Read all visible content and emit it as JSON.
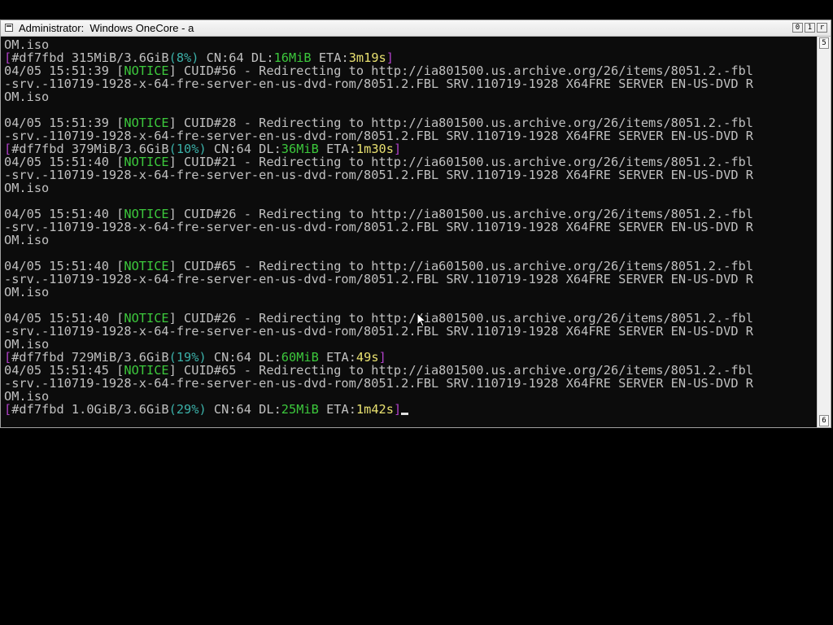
{
  "window": {
    "title": "Administrator:  Windows OneCore - a",
    "caption_buttons": [
      "0",
      "1",
      "r"
    ]
  },
  "scrollbar": {
    "up_label": "5",
    "down_label": "6"
  },
  "console": {
    "lines": [
      {
        "segments": [
          {
            "text": "OM.iso",
            "color": "default"
          }
        ]
      },
      {
        "segments": [
          {
            "text": "[",
            "color": "purple"
          },
          {
            "text": "#df7fbd 315MiB/3.6GiB",
            "color": "default"
          },
          {
            "text": "(8%)",
            "color": "cyan"
          },
          {
            "text": " CN:64 DL:",
            "color": "default"
          },
          {
            "text": "16MiB",
            "color": "green"
          },
          {
            "text": " ETA:",
            "color": "default"
          },
          {
            "text": "3m19s",
            "color": "yellow"
          },
          {
            "text": "]",
            "color": "purple"
          }
        ]
      },
      {
        "segments": [
          {
            "text": "04/05 15:51:39 [",
            "color": "default"
          },
          {
            "text": "NOTICE",
            "color": "green"
          },
          {
            "text": "] CUID#56 - Redirecting to http://ia801500.us.archive.org/26/items/8051.2.-fbl",
            "color": "default"
          }
        ]
      },
      {
        "segments": [
          {
            "text": "-srv.-110719-1928-x-64-fre-server-en-us-dvd-rom/8051.2.FBL_SRV.110719-1928_X64FRE_SERVER_EN-US-DVD_R",
            "color": "default"
          }
        ]
      },
      {
        "segments": [
          {
            "text": "OM.iso",
            "color": "default"
          }
        ]
      },
      {
        "segments": [
          {
            "text": "",
            "color": "default"
          }
        ]
      },
      {
        "segments": [
          {
            "text": "04/05 15:51:39 [",
            "color": "default"
          },
          {
            "text": "NOTICE",
            "color": "green"
          },
          {
            "text": "] CUID#28 - Redirecting to http://ia801500.us.archive.org/26/items/8051.2.-fbl",
            "color": "default"
          }
        ]
      },
      {
        "segments": [
          {
            "text": "-srv.-110719-1928-x-64-fre-server-en-us-dvd-rom/8051.2.FBL_SRV.110719-1928_X64FRE_SERVER_EN-US-DVD_R",
            "color": "default"
          }
        ]
      },
      {
        "segments": [
          {
            "text": "[",
            "color": "purple"
          },
          {
            "text": "#df7fbd 379MiB/3.6GiB",
            "color": "default"
          },
          {
            "text": "(10%)",
            "color": "cyan"
          },
          {
            "text": " CN:64 DL:",
            "color": "default"
          },
          {
            "text": "36MiB",
            "color": "green"
          },
          {
            "text": " ETA:",
            "color": "default"
          },
          {
            "text": "1m30s",
            "color": "yellow"
          },
          {
            "text": "]",
            "color": "purple"
          }
        ]
      },
      {
        "segments": [
          {
            "text": "04/05 15:51:40 [",
            "color": "default"
          },
          {
            "text": "NOTICE",
            "color": "green"
          },
          {
            "text": "] CUID#21 - Redirecting to http://ia601500.us.archive.org/26/items/8051.2.-fbl",
            "color": "default"
          }
        ]
      },
      {
        "segments": [
          {
            "text": "-srv.-110719-1928-x-64-fre-server-en-us-dvd-rom/8051.2.FBL_SRV.110719-1928_X64FRE_SERVER_EN-US-DVD_R",
            "color": "default"
          }
        ]
      },
      {
        "segments": [
          {
            "text": "OM.iso",
            "color": "default"
          }
        ]
      },
      {
        "segments": [
          {
            "text": "",
            "color": "default"
          }
        ]
      },
      {
        "segments": [
          {
            "text": "04/05 15:51:40 [",
            "color": "default"
          },
          {
            "text": "NOTICE",
            "color": "green"
          },
          {
            "text": "] CUID#26 - Redirecting to http://ia801500.us.archive.org/26/items/8051.2.-fbl",
            "color": "default"
          }
        ]
      },
      {
        "segments": [
          {
            "text": "-srv.-110719-1928-x-64-fre-server-en-us-dvd-rom/8051.2.FBL_SRV.110719-1928_X64FRE_SERVER_EN-US-DVD_R",
            "color": "default"
          }
        ]
      },
      {
        "segments": [
          {
            "text": "OM.iso",
            "color": "default"
          }
        ]
      },
      {
        "segments": [
          {
            "text": "",
            "color": "default"
          }
        ]
      },
      {
        "segments": [
          {
            "text": "04/05 15:51:40 [",
            "color": "default"
          },
          {
            "text": "NOTICE",
            "color": "green"
          },
          {
            "text": "] CUID#65 - Redirecting to http://ia601500.us.archive.org/26/items/8051.2.-fbl",
            "color": "default"
          }
        ]
      },
      {
        "segments": [
          {
            "text": "-srv.-110719-1928-x-64-fre-server-en-us-dvd-rom/8051.2.FBL_SRV.110719-1928_X64FRE_SERVER_EN-US-DVD_R",
            "color": "default"
          }
        ]
      },
      {
        "segments": [
          {
            "text": "OM.iso",
            "color": "default"
          }
        ]
      },
      {
        "segments": [
          {
            "text": "",
            "color": "default"
          }
        ]
      },
      {
        "segments": [
          {
            "text": "04/05 15:51:40 [",
            "color": "default"
          },
          {
            "text": "NOTICE",
            "color": "green"
          },
          {
            "text": "] CUID#26 - Redirecting to http://ia801500.us.archive.org/26/items/8051.2.-fbl",
            "color": "default"
          }
        ]
      },
      {
        "segments": [
          {
            "text": "-srv.-110719-1928-x-64-fre-server-en-us-dvd-rom/8051.2.FBL_SRV.110719-1928_X64FRE_SERVER_EN-US-DVD_R",
            "color": "default"
          }
        ]
      },
      {
        "segments": [
          {
            "text": "OM.iso",
            "color": "default"
          }
        ]
      },
      {
        "segments": [
          {
            "text": "[",
            "color": "purple"
          },
          {
            "text": "#df7fbd 729MiB/3.6GiB",
            "color": "default"
          },
          {
            "text": "(19%)",
            "color": "cyan"
          },
          {
            "text": " CN:64 DL:",
            "color": "default"
          },
          {
            "text": "60MiB",
            "color": "green"
          },
          {
            "text": " ETA:",
            "color": "default"
          },
          {
            "text": "49s",
            "color": "yellow"
          },
          {
            "text": "]",
            "color": "purple"
          }
        ]
      },
      {
        "segments": [
          {
            "text": "04/05 15:51:45 [",
            "color": "default"
          },
          {
            "text": "NOTICE",
            "color": "green"
          },
          {
            "text": "] CUID#65 - Redirecting to http://ia801500.us.archive.org/26/items/8051.2.-fbl",
            "color": "default"
          }
        ]
      },
      {
        "segments": [
          {
            "text": "-srv.-110719-1928-x-64-fre-server-en-us-dvd-rom/8051.2.FBL_SRV.110719-1928_X64FRE_SERVER_EN-US-DVD_R",
            "color": "default"
          }
        ]
      },
      {
        "segments": [
          {
            "text": "OM.iso",
            "color": "default"
          }
        ]
      },
      {
        "segments": [
          {
            "text": "[",
            "color": "purple"
          },
          {
            "text": "#df7fbd 1.0GiB/3.6GiB",
            "color": "default"
          },
          {
            "text": "(29%)",
            "color": "cyan"
          },
          {
            "text": " CN:64 DL:",
            "color": "default"
          },
          {
            "text": "25MiB",
            "color": "green"
          },
          {
            "text": " ETA:",
            "color": "default"
          },
          {
            "text": "1m42s",
            "color": "yellow"
          },
          {
            "text": "]",
            "color": "purple"
          }
        ],
        "cursor": true
      }
    ]
  },
  "colors": {
    "console_bg": "#0c0c0c",
    "default_text": "#c0c0c0",
    "purple": "#b040c8",
    "cyan": "#3bb0a8",
    "green": "#3cc83c",
    "yellow": "#e8e070"
  }
}
